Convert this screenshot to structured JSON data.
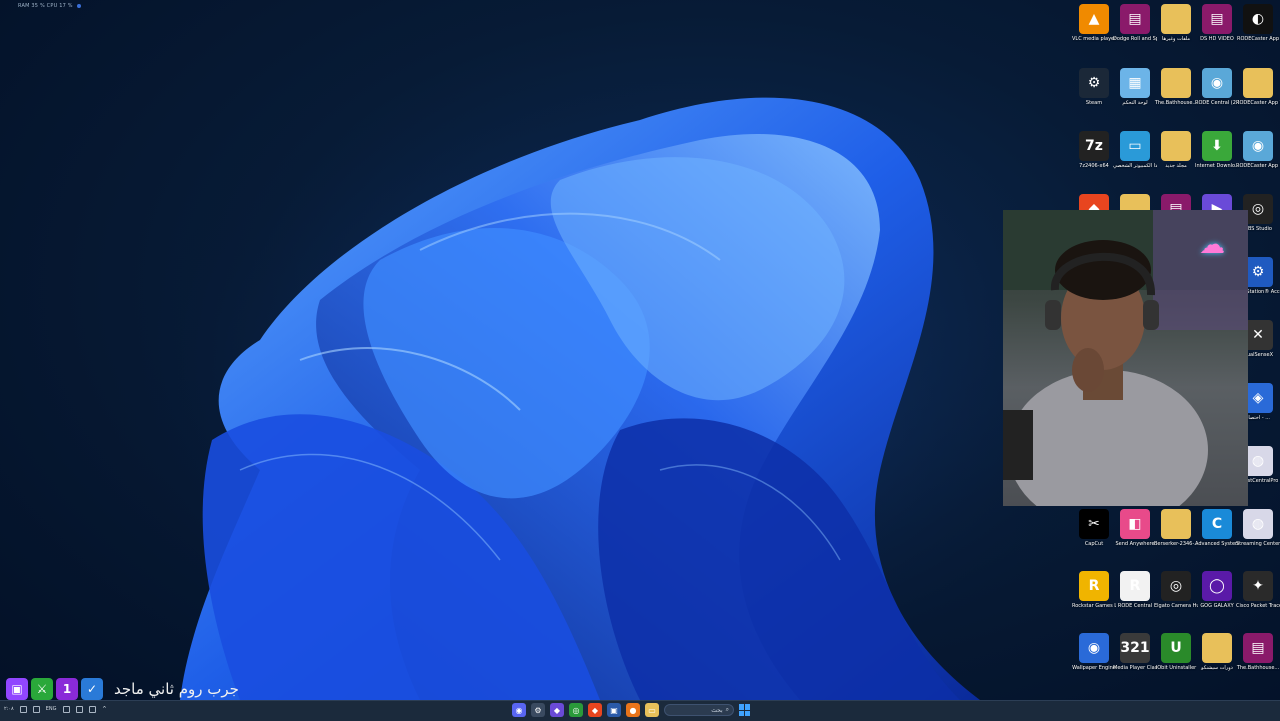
{
  "system": {
    "perf_text": "RAM 35 %   CPU 17 %"
  },
  "desktop_icons": [
    {
      "name": "vlc-icon",
      "label": "VLC media player",
      "color": "#f08a00",
      "glyph": "▲"
    },
    {
      "name": "winrar-icon",
      "label": "Dodge Roll and Sprint-496-2-30...",
      "color": "#8a1a6a",
      "glyph": "▤"
    },
    {
      "name": "folder-icon",
      "label": "ملفات وغيرها",
      "color": "#e8c05a",
      "glyph": ""
    },
    {
      "name": "winrar-icon",
      "label": "DS HD VIDEO",
      "color": "#8a1a6a",
      "glyph": "▤"
    },
    {
      "name": "rodecaster-icon",
      "label": "RODECaster App",
      "color": "#111",
      "glyph": "◐"
    },
    {
      "name": "steam-icon",
      "label": "Steam",
      "color": "#1b2838",
      "glyph": "⚙"
    },
    {
      "name": "control-panel-icon",
      "label": "لوحة التحكم",
      "color": "#6cb4e8",
      "glyph": "▦"
    },
    {
      "name": "folder-icon",
      "label": "The.Bathhouse...",
      "color": "#e8c05a",
      "glyph": ""
    },
    {
      "name": "installer-icon",
      "label": "RODE Central (2.0.65)",
      "color": "#5aa8d8",
      "glyph": "◉"
    },
    {
      "name": "folder-icon",
      "label": "RODECaster App Windows v2.0.102",
      "color": "#e8c05a",
      "glyph": ""
    },
    {
      "name": "7zip-icon",
      "label": "7z2406-x64",
      "color": "#222",
      "glyph": "7z"
    },
    {
      "name": "monitor-icon",
      "label": "هذا الكمبيوتر الشخصي",
      "color": "#2a9ad8",
      "glyph": "▭"
    },
    {
      "name": "folder-icon",
      "label": "مجلد جديد",
      "color": "#e8c05a",
      "glyph": ""
    },
    {
      "name": "idm-icon",
      "label": "Internet Downlo...",
      "color": "#3aa83a",
      "glyph": "⬇"
    },
    {
      "name": "installer-icon",
      "label": "RODECaster App (2.0.102)",
      "color": "#5aa8d8",
      "glyph": "◉"
    },
    {
      "name": "brave-icon",
      "label": "",
      "color": "#e8451f",
      "glyph": "◆"
    },
    {
      "name": "folder-icon",
      "label": "",
      "color": "#e8c05a",
      "glyph": ""
    },
    {
      "name": "winrar-icon",
      "label": "",
      "color": "#8a1a6a",
      "glyph": "▤"
    },
    {
      "name": "app-icon",
      "label": "",
      "color": "#6a4ad8",
      "glyph": "▶"
    },
    {
      "name": "obs-icon",
      "label": "OBS Studio",
      "color": "#222",
      "glyph": "◎"
    },
    {
      "name": "playstation-icon",
      "label": "PlayStation® Accessories",
      "color": "#1f5ac0",
      "glyph": "⚙"
    },
    {
      "name": "dualsense-icon",
      "label": "DualSenseX",
      "color": "#333",
      "glyph": "✕"
    },
    {
      "name": "app-icon",
      "label": "اختصار - ...",
      "color": "#2a6ad8",
      "glyph": "◈"
    },
    {
      "name": "assist-icon",
      "label": "AssistCentralPro",
      "color": "#d8d8e8",
      "glyph": "◍"
    },
    {
      "name": "capcut-icon",
      "label": "CapCut",
      "color": "#000",
      "glyph": "✂"
    },
    {
      "name": "send-anywhere-icon",
      "label": "Send Anywhere",
      "color": "#e84a8a",
      "glyph": "◧"
    },
    {
      "name": "folder-icon",
      "label": "Berserker-2346-...",
      "color": "#e8c05a",
      "glyph": ""
    },
    {
      "name": "ccleaner-icon",
      "label": "Advanced SystemCare",
      "color": "#1a8ad8",
      "glyph": "C"
    },
    {
      "name": "streaming-center-icon",
      "label": "Streaming Center",
      "color": "#d8d8e8",
      "glyph": "◍"
    },
    {
      "name": "rockstar-icon",
      "label": "Rockstar Games Launcher",
      "color": "#f0b400",
      "glyph": "R"
    },
    {
      "name": "rode-icon",
      "label": "RODE Central",
      "color": "#f2f2f2",
      "glyph": "R"
    },
    {
      "name": "elgato-icon",
      "label": "Elgato Camera Hub",
      "color": "#222",
      "glyph": "◎"
    },
    {
      "name": "gog-icon",
      "label": "GOG GALAXY",
      "color": "#5a1aa8",
      "glyph": "◯"
    },
    {
      "name": "cisco-icon",
      "label": "Cisco Packet Tracer",
      "color": "#2a2a2a",
      "glyph": "✦"
    },
    {
      "name": "wallpaper-engine-icon",
      "label": "Wallpaper Engine",
      "color": "#2a6ad8",
      "glyph": "◉"
    },
    {
      "name": "mpc-icon",
      "label": "Media Player Classic",
      "color": "#3a3a3a",
      "glyph": "321"
    },
    {
      "name": "iobit-icon",
      "label": "IObit Uninstaller",
      "color": "#2a8a2a",
      "glyph": "U"
    },
    {
      "name": "folder-icon",
      "label": "دورات سيشنكو",
      "color": "#e8c05a",
      "glyph": ""
    },
    {
      "name": "winrar-icon",
      "label": "The.Bathhouse...",
      "color": "#8a1a6a",
      "glyph": "▤"
    }
  ],
  "stream_overlay": {
    "text": "جرب روم ثاني ماجد",
    "icons": [
      {
        "name": "twitch-icon",
        "color": "#9146ff",
        "glyph": "▣"
      },
      {
        "name": "sword-icon",
        "color": "#2aa83a",
        "glyph": "⚔"
      },
      {
        "name": "first-badge-icon",
        "color": "#8a2ad8",
        "glyph": "1"
      },
      {
        "name": "check-icon",
        "color": "#2a7ad8",
        "glyph": "✓"
      }
    ]
  },
  "taskbar": {
    "tray_lang": "ENG",
    "tray_time": "٢:٠٨",
    "search_placeholder": "بحث"
  }
}
